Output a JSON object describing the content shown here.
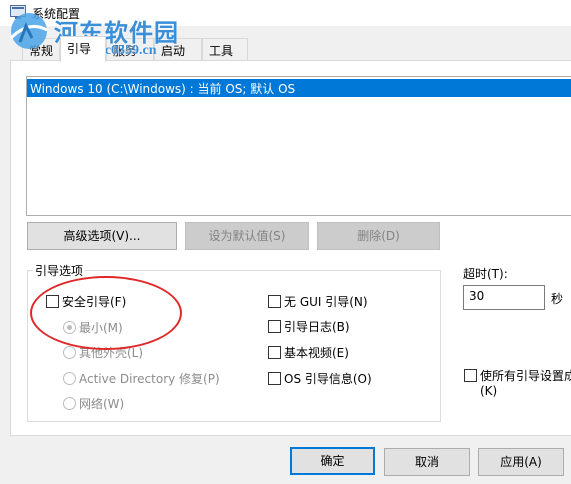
{
  "window": {
    "title": "系统配置"
  },
  "watermark": {
    "title": "河东软件园",
    "url": "www.pc0359.cn"
  },
  "tabs": [
    "常规",
    "引导",
    "服务",
    "启动",
    "工具"
  ],
  "os_list": {
    "items": [
      "Windows 10 (C:\\Windows) : 当前 OS; 默认 OS"
    ]
  },
  "buttons": {
    "advanced": "高级选项(V)...",
    "set_default": "设为默认值(S)",
    "delete": "删除(D)",
    "ok": "确定",
    "cancel": "取消",
    "apply": "应用(A)"
  },
  "boot_options": {
    "group_label": "引导选项",
    "safe_boot": "安全引导(F)",
    "minimal": "最小(M)",
    "alternate_shell": "其他外壳(L)",
    "active_directory": "Active Directory 修复(P)",
    "network": "网络(W)",
    "no_gui": "无 GUI 引导(N)",
    "boot_log": "引导日志(B)",
    "base_video": "基本视频(E)",
    "os_boot_info": "OS 引导信息(O)"
  },
  "timeout": {
    "label": "超时(T):",
    "value": "30",
    "unit": "秒"
  },
  "permanent": {
    "label_line1": "使所有引导设置成",
    "label_line2": "(K)"
  },
  "colors": {
    "accent": "#0078d7",
    "annotation_circle": "#e02828",
    "watermark": "#3a8fd8"
  }
}
